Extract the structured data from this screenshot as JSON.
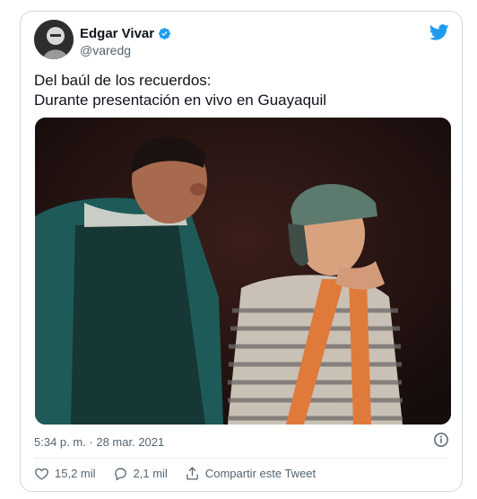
{
  "author": {
    "name": "Edgar Vivar",
    "handle": "@varedg",
    "verified": true,
    "avatar_icon": "avatar-photo"
  },
  "tweet": {
    "lines": [
      "Del baúl de los recuerdos:",
      "Durante presentación en vivo en Guayaquil"
    ],
    "timestamp": "5:34 p. m. · 28 mar. 2021"
  },
  "actions": {
    "likes": "15,2 mil",
    "replies": "2,1 mil",
    "share_label": "Compartir este Tweet"
  },
  "icons": {
    "brand": "twitter-bird-icon",
    "verified": "verified-badge-icon",
    "info": "info-icon",
    "like": "heart-icon",
    "reply": "reply-bubble-icon",
    "share": "share-icon"
  },
  "colors": {
    "brand_blue": "#1d9bf0",
    "secondary_text": "#536471",
    "border": "#cfd9de"
  }
}
